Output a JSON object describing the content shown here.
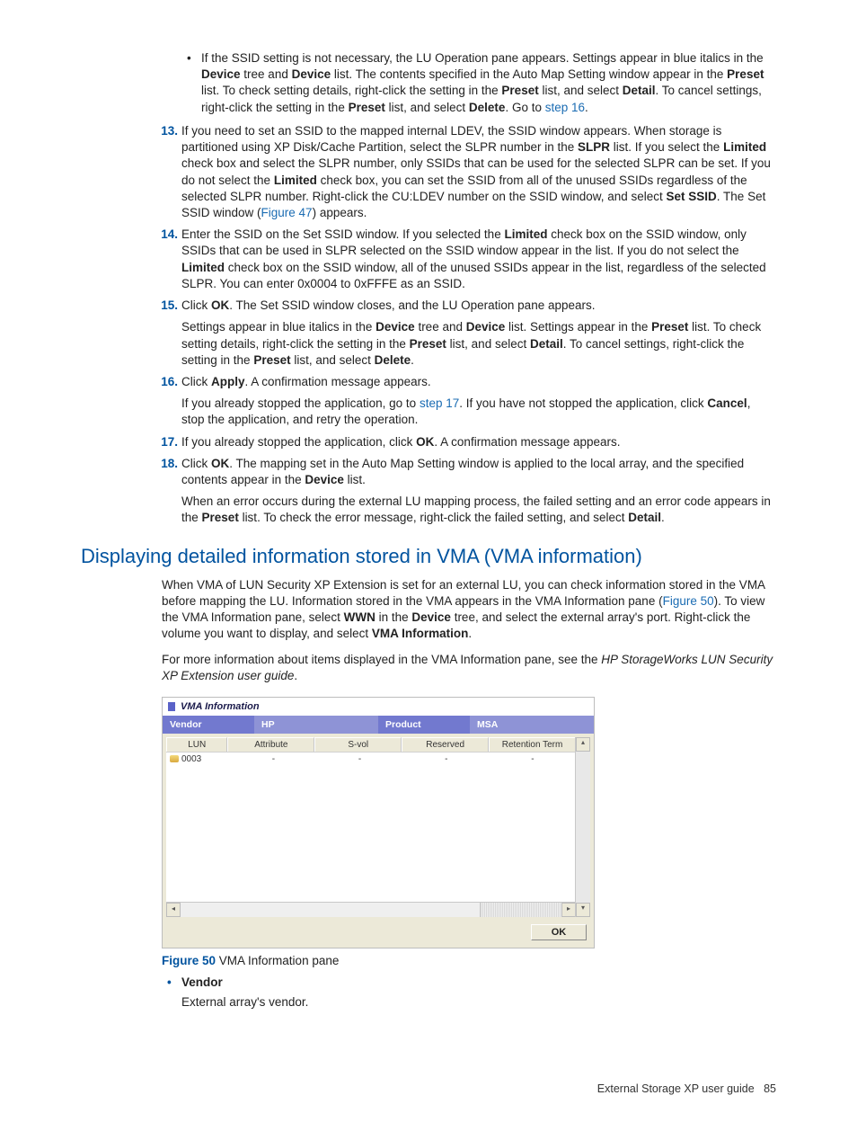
{
  "bullet1": {
    "pre": "If the SSID setting is not necessary, the LU Operation pane appears. Settings appear in blue italics in the ",
    "b1": "Device",
    "t1": " tree and ",
    "b2": "Device",
    "t2": " list. The contents specified in the Auto Map Setting window appear in the ",
    "b3": "Preset",
    "t3": " list. To check setting details, right-click the setting in the ",
    "b4": "Preset",
    "t4": " list, and select ",
    "b5": "Detail",
    "t5": ". To cancel settings, right-click the setting in the ",
    "b6": "Preset",
    "t6": " list, and select ",
    "b7": "Delete",
    "t7": ". Go to ",
    "link1": "step 16",
    "t8": "."
  },
  "s13": {
    "num": "13.",
    "t1": "If you need to set an SSID to the mapped internal LDEV, the SSID window appears. When storage is partitioned using XP Disk/Cache Partition, select the SLPR number in the ",
    "b1": "SLPR",
    "t2": " list. If you select the ",
    "b2": "Limited",
    "t3": " check box and select the SLPR number, only SSIDs that can be used for the selected SLPR can be set. If you do not select the ",
    "b3": "Limited",
    "t4": " check box, you can set the SSID from all of the unused SSIDs regardless of the selected SLPR number. Right-click the CU:LDEV number on the SSID window, and select ",
    "b4": "Set SSID",
    "t5": ". The Set SSID window (",
    "link1": "Figure 47",
    "t6": ") appears."
  },
  "s14": {
    "num": "14.",
    "t1": "Enter the SSID on the Set SSID window. If you selected the ",
    "b1": "Limited",
    "t2": " check box on the SSID window, only SSIDs that can be used in SLPR selected on the SSID window appear in the list. If you do not select the ",
    "b2": "Limited",
    "t3": " check box on the SSID window, all of the unused SSIDs appear in the list, regardless of the selected SLPR. You can enter 0x0004 to 0xFFFE as an SSID."
  },
  "s15": {
    "num": "15.",
    "t1": "Click ",
    "b1": "OK",
    "t2": ". The Set SSID window closes, and the LU Operation pane appears.",
    "sub_t1": "Settings appear in blue italics in the ",
    "sub_b1": "Device",
    "sub_t2": " tree and ",
    "sub_b2": "Device",
    "sub_t3": " list. Settings appear in the ",
    "sub_b3": "Preset",
    "sub_t4": " list. To check setting details, right-click the setting in the ",
    "sub_b4": "Preset",
    "sub_t5": " list, and select ",
    "sub_b5": "Detail",
    "sub_t6": ". To cancel settings, right-click the setting in the ",
    "sub_b6": "Preset",
    "sub_t7": " list, and select ",
    "sub_b7": "Delete",
    "sub_t8": "."
  },
  "s16": {
    "num": "16.",
    "t1": "Click ",
    "b1": "Apply",
    "t2": ". A confirmation message appears.",
    "sub_t1": "If you already stopped the application, go to ",
    "sub_link1": "step 17",
    "sub_t2": ". If you have not stopped the application, click ",
    "sub_b1": "Cancel",
    "sub_t3": ", stop the application, and retry the operation."
  },
  "s17": {
    "num": "17.",
    "t1": "If you already stopped the application, click ",
    "b1": "OK",
    "t2": ". A confirmation message appears."
  },
  "s18": {
    "num": "18.",
    "t1": "Click ",
    "b1": "OK",
    "t2": ". The mapping set in the Auto Map Setting window is applied to the local array, and the specified contents appear in the ",
    "b2": "Device",
    "t3": " list.",
    "sub_t1": "When an error occurs during the external LU mapping process, the failed setting and an error code appears in the ",
    "sub_b1": "Preset",
    "sub_t2": " list. To check the error message, right-click the failed setting, and select ",
    "sub_b2": "Detail",
    "sub_t3": "."
  },
  "section_title": "Displaying detailed information stored in VMA (VMA information)",
  "para1": {
    "t1": "When VMA of LUN Security XP Extension is set for an external LU, you can check information stored in the VMA before mapping the LU. Information stored in the VMA appears in the VMA Information pane (",
    "link1": "Figure 50",
    "t2": "). To view the VMA Information pane, select ",
    "b1": "WWN",
    "t3": " in the ",
    "b2": "Device",
    "t4": " tree, and select the external array's port. Right-click the volume you want to display, and select ",
    "b3": "VMA Information",
    "t5": "."
  },
  "para2": {
    "t1": "For more information about items displayed in the VMA Information pane, see the ",
    "i1": "HP StorageWorks LUN Security XP Extension user guide",
    "t2": "."
  },
  "vma": {
    "title": "VMA Information",
    "vendor_label": "Vendor",
    "vendor_value": "HP",
    "product_label": "Product",
    "product_value": "MSA",
    "cols": {
      "c1": "LUN",
      "c2": "Attribute",
      "c3": "S-vol",
      "c4": "Reserved",
      "c5": "Retention Term"
    },
    "row": {
      "lun": "0003",
      "attr": "-",
      "svol": "-",
      "reserved": "-",
      "term": "-"
    },
    "ok": "OK"
  },
  "figcap": {
    "label": "Figure 50",
    "text": " VMA Information pane"
  },
  "vendor_item": {
    "label": "Vendor",
    "desc": "External array's vendor."
  },
  "footer": {
    "title": "External Storage XP user guide",
    "page": "85"
  }
}
